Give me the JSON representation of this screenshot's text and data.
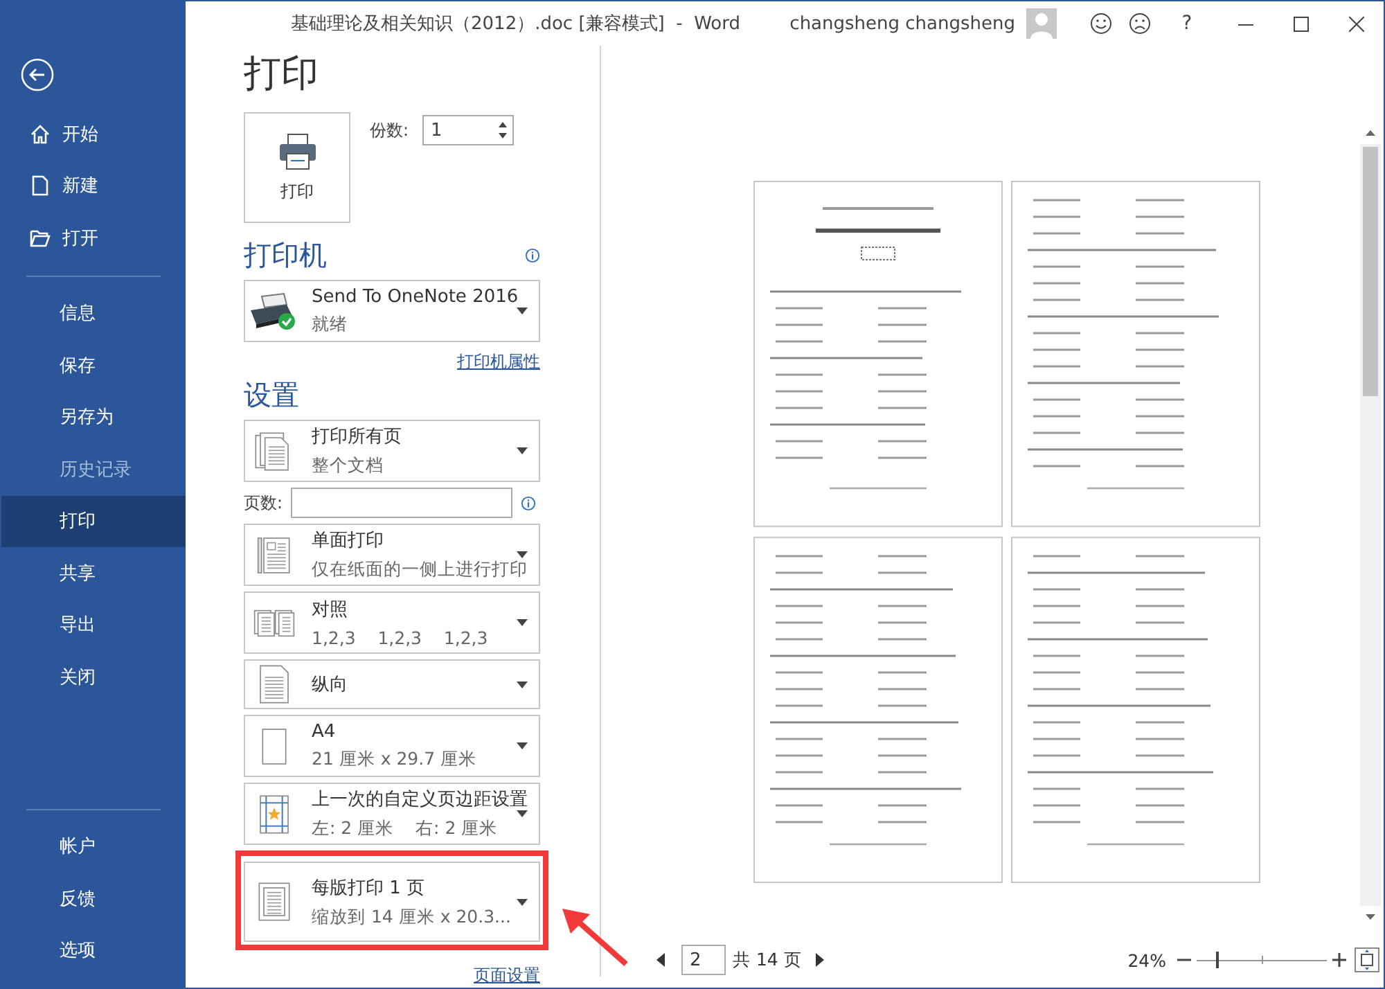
{
  "window": {
    "title": "基础理论及相关知识（2012）.doc [兼容模式]  -  Word",
    "user": "changsheng changsheng",
    "help": "?"
  },
  "sidebar": {
    "top_items": [
      {
        "label": "开始",
        "selected": false,
        "disabled": false
      },
      {
        "label": "新建",
        "selected": false,
        "disabled": false
      },
      {
        "label": "打开",
        "selected": false,
        "disabled": false
      }
    ],
    "items": [
      {
        "label": "信息",
        "selected": false,
        "disabled": false
      },
      {
        "label": "保存",
        "selected": false,
        "disabled": false
      },
      {
        "label": "另存为",
        "selected": false,
        "disabled": false
      },
      {
        "label": "历史记录",
        "selected": false,
        "disabled": true
      },
      {
        "label": "打印",
        "selected": true,
        "disabled": false
      },
      {
        "label": "共享",
        "selected": false,
        "disabled": false
      },
      {
        "label": "导出",
        "selected": false,
        "disabled": false
      },
      {
        "label": "关闭",
        "selected": false,
        "disabled": false
      }
    ],
    "bottom_items": [
      {
        "label": "帐户",
        "selected": false,
        "disabled": false
      },
      {
        "label": "反馈",
        "selected": false,
        "disabled": false
      },
      {
        "label": "选项",
        "selected": false,
        "disabled": false
      }
    ]
  },
  "heading": "打印",
  "print_button": "打印",
  "copies": {
    "label": "份数:",
    "value": "1"
  },
  "printer": {
    "heading": "打印机",
    "name": "Send To OneNote 2016",
    "status": "就绪",
    "link": "打印机属性"
  },
  "settings": {
    "heading": "设置",
    "pages": {
      "label": "页数:"
    },
    "items": [
      {
        "kind": "dropdown",
        "title": "打印所有页",
        "subtitle": "整个文档",
        "highlighted": false
      },
      {
        "kind": "field"
      },
      {
        "kind": "dropdown",
        "title": "单面打印",
        "subtitle": "仅在纸面的一侧上进行打印",
        "highlighted": false
      },
      {
        "kind": "dropdown",
        "title": "对照",
        "subtitle": "1,2,3    1,2,3    1,2,3",
        "highlighted": false
      },
      {
        "kind": "dropdown",
        "title": "纵向",
        "highlighted": false
      },
      {
        "kind": "dropdown",
        "title": "A4",
        "subtitle": "21 厘米 x 29.7 厘米",
        "highlighted": false
      },
      {
        "kind": "dropdown",
        "title": "上一次的自定义页边距设置",
        "subtitle": "左: 2 厘米    右: 2 厘米",
        "highlighted": false
      },
      {
        "kind": "dropdown",
        "title": "每版打印 1 页",
        "subtitle": "缩放到 14 厘米 x 20.3...",
        "highlighted": true
      }
    ],
    "link": "页面设置"
  },
  "preview": {
    "page": "2",
    "total": "共 14 页",
    "zoom": "24%",
    "zoom_slider": {
      "level": 0.15
    }
  }
}
